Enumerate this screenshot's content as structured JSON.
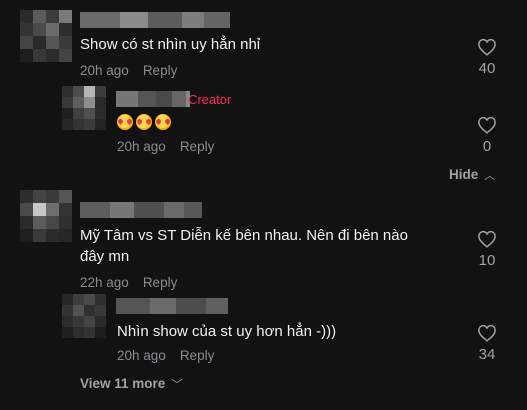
{
  "comments": [
    {
      "text": "Show có st nhìn uy hẳn nhỉ",
      "time": "20h ago",
      "reply_label": "Reply",
      "likes": "40"
    },
    {
      "text_line1": "Mỹ Tâm vs ST Diễn kế bên nhau. Nên đi bên nào",
      "text_line2": "đây mn",
      "time": "22h ago",
      "reply_label": "Reply",
      "likes": "10"
    }
  ],
  "replies": [
    {
      "badge": "· Creator",
      "emoji": [
        "smiling-face-with-hearts-emoji",
        "smiling-face-with-hearts-emoji",
        "smiling-face-with-hearts-emoji"
      ],
      "time": "20h ago",
      "reply_label": "Reply",
      "likes": "0"
    },
    {
      "text": "Nhìn show của st uy hơn hẳn -)))",
      "time": "20h ago",
      "reply_label": "Reply",
      "likes": "34"
    }
  ],
  "hide_label": "Hide",
  "view_more_label": "View 11 more",
  "icons": {
    "like": "heart-outline-icon",
    "hide": "chevron-up-icon",
    "view_more": "chevron-down-icon"
  },
  "colors": {
    "background": "#121212",
    "creator": "#fe2c55",
    "muted": "#8a8b91"
  }
}
